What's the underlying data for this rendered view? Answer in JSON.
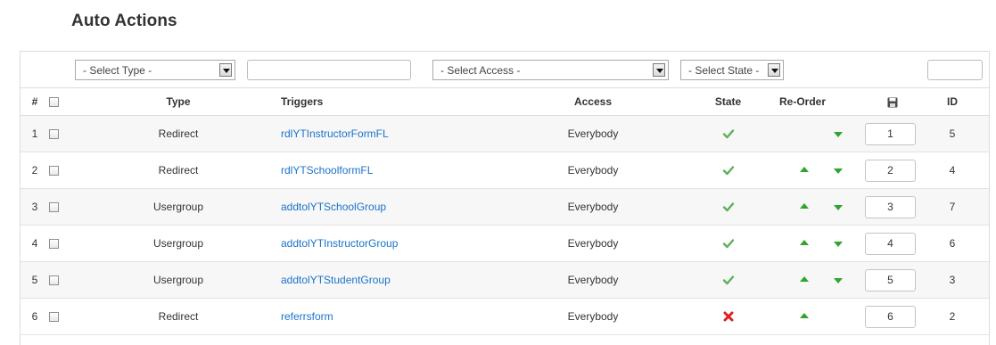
{
  "page": {
    "title": "Auto Actions"
  },
  "filters": {
    "type_select": "- Select Type -",
    "search_value": "",
    "access_select": "- Select Access -",
    "state_select": "- Select State -",
    "limit_value": ""
  },
  "columns": {
    "num": "#",
    "type": "Type",
    "triggers": "Triggers",
    "access": "Access",
    "state": "State",
    "reorder": "Re-Order",
    "save_icon": "save-icon",
    "id": "ID"
  },
  "rows": [
    {
      "num": "1",
      "type": "Redirect",
      "trigger": "rdlYTInstructorFormFL",
      "access": "Everybody",
      "state": "published",
      "can_up": false,
      "can_down": true,
      "order": "1",
      "id": "5"
    },
    {
      "num": "2",
      "type": "Redirect",
      "trigger": "rdlYTSchoolformFL",
      "access": "Everybody",
      "state": "published",
      "can_up": true,
      "can_down": true,
      "order": "2",
      "id": "4"
    },
    {
      "num": "3",
      "type": "Usergroup",
      "trigger": "addtolYTSchoolGroup",
      "access": "Everybody",
      "state": "published",
      "can_up": true,
      "can_down": true,
      "order": "3",
      "id": "7"
    },
    {
      "num": "4",
      "type": "Usergroup",
      "trigger": "addtolYTInstructorGroup",
      "access": "Everybody",
      "state": "published",
      "can_up": true,
      "can_down": true,
      "order": "4",
      "id": "6"
    },
    {
      "num": "5",
      "type": "Usergroup",
      "trigger": "addtolYTStudentGroup",
      "access": "Everybody",
      "state": "published",
      "can_up": true,
      "can_down": true,
      "order": "5",
      "id": "3"
    },
    {
      "num": "6",
      "type": "Redirect",
      "trigger": "referrsform",
      "access": "Everybody",
      "state": "unpublished",
      "can_up": true,
      "can_down": false,
      "order": "6",
      "id": "2"
    }
  ],
  "colors": {
    "link": "#1a73c8",
    "check": "#5bb15b",
    "cross": "#e02020",
    "arrow": "#2fa52f"
  }
}
